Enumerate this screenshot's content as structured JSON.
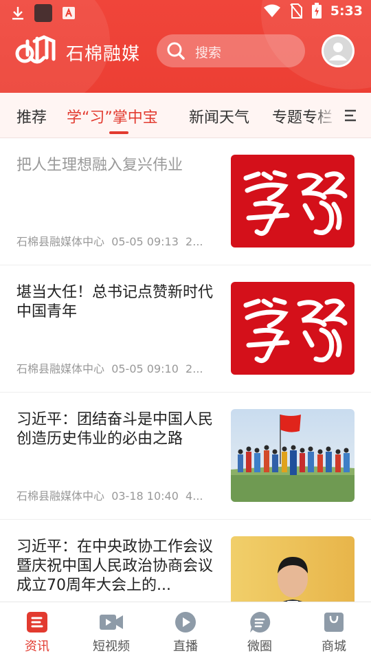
{
  "status_bar": {
    "time": "5:33"
  },
  "header": {
    "app_name": "石棉融媒",
    "search_placeholder": "搜索"
  },
  "tabs": [
    {
      "label": "推荐",
      "active": false
    },
    {
      "label": "学“习”掌中宝",
      "active": true
    },
    {
      "label": "新闻天气",
      "active": false
    },
    {
      "label": "专题专栏",
      "active": false
    }
  ],
  "feed": [
    {
      "title": "把人生理想融入复兴伟业",
      "source": "石棉县融媒体中心",
      "time": "05-05 09:13",
      "extra": "2...",
      "read": true,
      "thumb": "xuexi"
    },
    {
      "title": "堪当大任！总书记点赞新时代中国青年",
      "source": "石棉县融媒体中心",
      "time": "05-05 09:10",
      "extra": "2...",
      "read": false,
      "thumb": "xuexi"
    },
    {
      "title": "习近平：团结奋斗是中国人民创造历史伟业的必由之路",
      "source": "石棉县融媒体中心",
      "time": "03-18 10:40",
      "extra": "4...",
      "read": false,
      "thumb": "grassland-dancers-photo"
    },
    {
      "title": "习近平：在中央政协工作会议暨庆祝中国人民政治协商会议成立70周年大会上的...",
      "source": "",
      "time": "",
      "extra": "",
      "read": false,
      "thumb": "speaker-photo"
    }
  ],
  "bottom_nav": [
    {
      "label": "资讯",
      "icon": "news-icon",
      "active": true
    },
    {
      "label": "短视频",
      "icon": "video-icon",
      "active": false
    },
    {
      "label": "直播",
      "icon": "live-icon",
      "active": false
    },
    {
      "label": "微圈",
      "icon": "chat-circle-icon",
      "active": false
    },
    {
      "label": "商城",
      "icon": "shop-bag-icon",
      "active": false
    }
  ],
  "colors": {
    "brand_red": "#ec3f34",
    "active_red": "#e23a2f"
  }
}
